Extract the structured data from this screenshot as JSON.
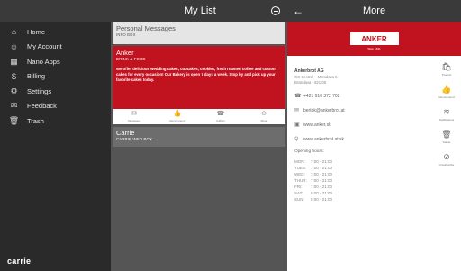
{
  "list_header": {
    "title": "My List"
  },
  "detail_header": {
    "title": "More"
  },
  "sidebar": {
    "items": [
      {
        "label": "Home"
      },
      {
        "label": "My Account"
      },
      {
        "label": "Nano Apps"
      },
      {
        "label": "Billing"
      },
      {
        "label": "Settings"
      },
      {
        "label": "Feedback"
      },
      {
        "label": "Trash"
      }
    ],
    "brand": "carrie"
  },
  "list": {
    "personal": {
      "title": "Personal Messages",
      "subtitle": "INFO BOX"
    },
    "anker": {
      "title": "Anker",
      "subtitle": "DRINK & FOOD",
      "description": "We offer delicious wedding cakes, cupcakes, cookies, fresh roasted coffee and custom cakes for every occasion! Our Bakery is open 7 days a week. Stop by and pick up your favorite cakes today.",
      "actions": [
        {
          "label": "Messages"
        },
        {
          "label": "Recommend"
        },
        {
          "label": "Call Us"
        },
        {
          "label": "More"
        }
      ]
    },
    "carrie": {
      "title": "Carrie",
      "subtitle": "CARRIE INFO BOX"
    }
  },
  "detail": {
    "logo": "ANKER",
    "logo_sub": "Wien 1891",
    "name": "Ankerbrot AG",
    "address": [
      "OC Central – Metodova 6",
      "Bratislava · 821 08"
    ],
    "phone": "+421 910 372 702",
    "email": "bertok@ankerbrot.at",
    "web1": "www.anker.sk",
    "web2": "www.ankerbrot.at/sk",
    "hours_title": "Opening hours:",
    "hours": [
      {
        "day": "MON:",
        "time": "7:00 - 21:00"
      },
      {
        "day": "TUES:",
        "time": "7:00 - 21:00"
      },
      {
        "day": "WED:",
        "time": "7:00 - 21:00"
      },
      {
        "day": "THUR:",
        "time": "7:00 - 21:00"
      },
      {
        "day": "FRI:",
        "time": "7:00 - 21:00"
      },
      {
        "day": "SAT:",
        "time": "8:00 - 21:00"
      },
      {
        "day": "SUN:",
        "time": "8:00 - 21:00"
      }
    ],
    "side_actions": [
      {
        "label": "Product"
      },
      {
        "label": "Recommend"
      },
      {
        "label": "Notifications"
      },
      {
        "label": "Delete"
      },
      {
        "label": "Unsubscribe"
      }
    ]
  }
}
